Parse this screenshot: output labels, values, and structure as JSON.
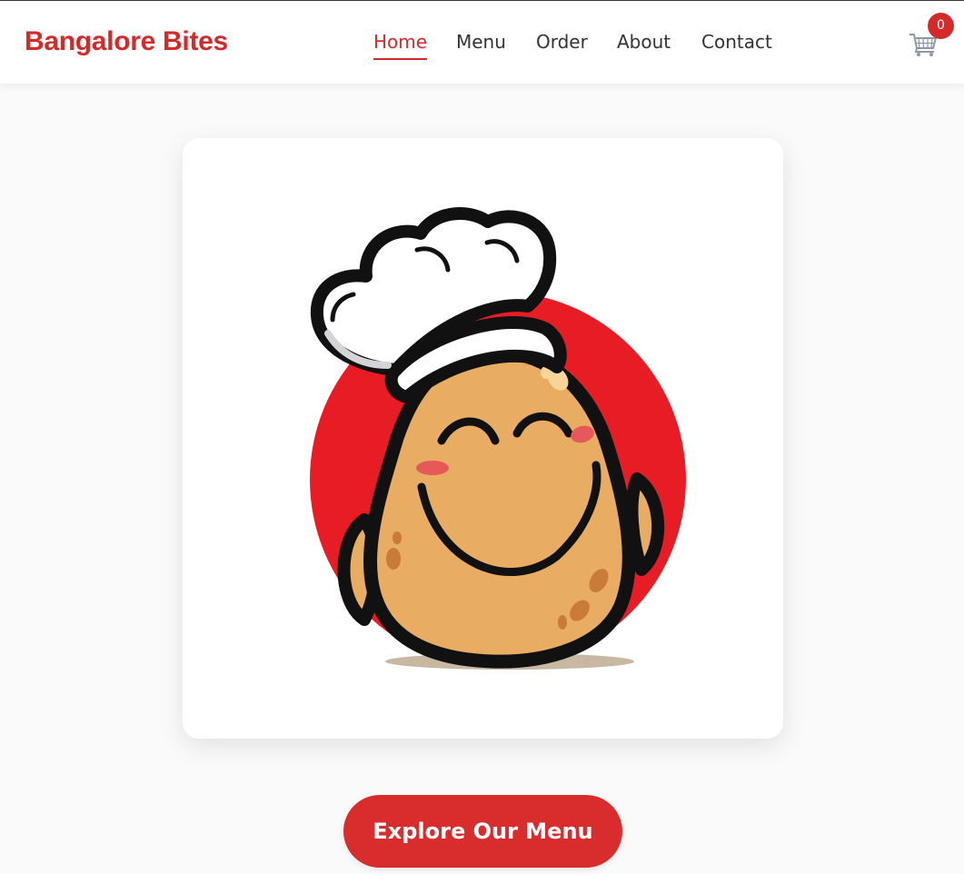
{
  "brand": {
    "name": "Bangalore Bites"
  },
  "nav": {
    "items": [
      {
        "label": "Home",
        "active": true
      },
      {
        "label": "Menu",
        "active": false
      },
      {
        "label": "Order",
        "active": false
      },
      {
        "label": "About",
        "active": false
      },
      {
        "label": "Contact",
        "active": false
      }
    ]
  },
  "cart": {
    "count": "0",
    "icon": "shopping-cart-icon"
  },
  "hero": {
    "image": "smiling-potato-chef-mascot"
  },
  "cta": {
    "label": "Explore Our Menu"
  },
  "colors": {
    "accent": "#d52a2a",
    "button": "#d92c2c",
    "background": "#fafafa"
  }
}
